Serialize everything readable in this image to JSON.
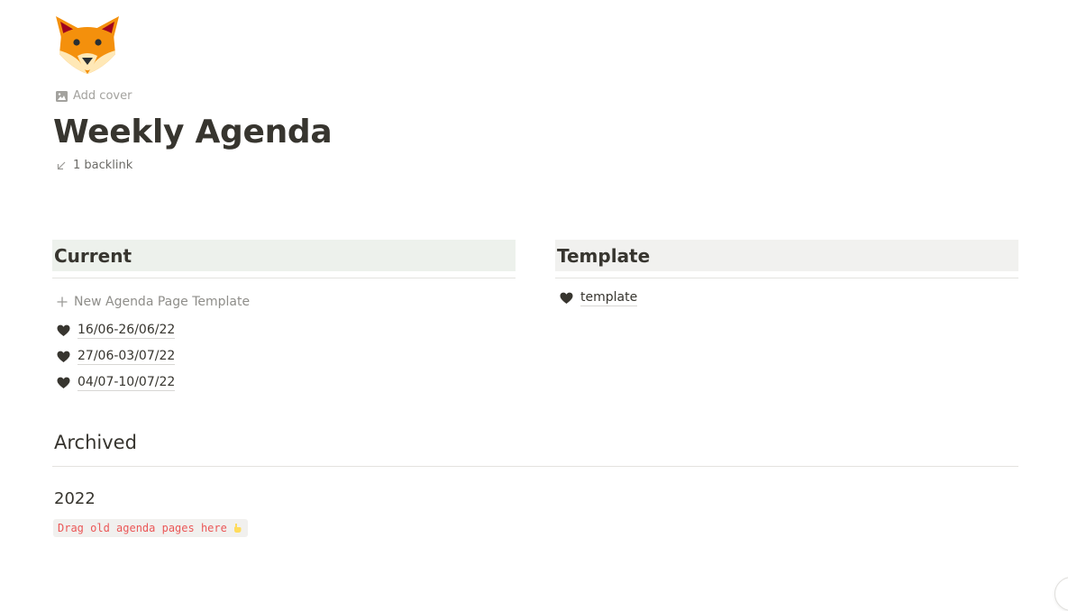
{
  "page": {
    "icon": "fox-face-icon",
    "add_cover_label": "Add cover",
    "title": "Weekly Agenda",
    "backlinks_label": "1 backlink"
  },
  "current": {
    "heading": "Current",
    "new_button_label": "New Agenda Page Template",
    "pages": [
      {
        "label": "16/06-26/06/22",
        "icon": "black-heart-icon"
      },
      {
        "label": "27/06-03/07/22",
        "icon": "black-heart-icon"
      },
      {
        "label": "04/07-10/07/22",
        "icon": "black-heart-icon"
      }
    ]
  },
  "template": {
    "heading": "Template",
    "pages": [
      {
        "label": "template",
        "icon": "black-heart-icon"
      }
    ]
  },
  "archived": {
    "heading": "Archived",
    "year_heading": "2022",
    "note": "Drag old agenda pages here",
    "note_icon": "pointing-down-hand-icon"
  },
  "colors": {
    "text": "#37352f",
    "current_heading_bg": "#edf1ec",
    "template_heading_bg": "#f1f1ef",
    "code_text": "#eb5757",
    "code_bg": "#f1f0ee",
    "muted_text": "#a3a29e"
  }
}
